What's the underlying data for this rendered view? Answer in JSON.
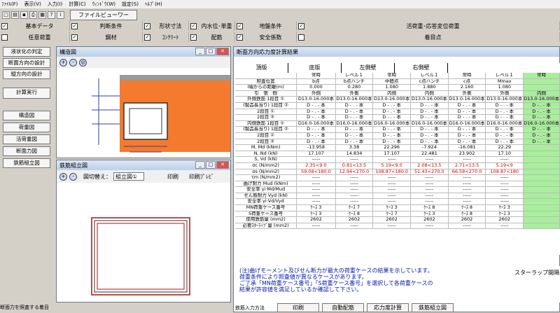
{
  "menu": [
    "ﾌｧｲﾙ(F)",
    "表示(V)",
    "入力(I)",
    "計算(C)",
    "ｳｨﾝﾄﾞｳ(W)",
    "設定(S)",
    "ﾍﾙﾌﾟ(H)"
  ],
  "toolbar": {
    "file_viewer": "ファイルビューワー"
  },
  "checks_row1": [
    {
      "label": "基本データ",
      "checked": true
    },
    {
      "label": "判断条件",
      "checked": true
    },
    {
      "label": "形状寸法",
      "checked": true
    },
    {
      "label": "内水位･単重",
      "checked": true
    },
    {
      "label": "地盤条件",
      "checked": true
    },
    {
      "label": "活荷重･応答変位荷重",
      "checked": true
    }
  ],
  "checks_row2": [
    {
      "label": "任意荷重",
      "checked": false
    },
    {
      "label": "鋼材",
      "checked": true
    },
    {
      "label": "ｺﾝｸﾘｰﾄ",
      "checked": true
    },
    {
      "label": "配筋",
      "checked": true
    },
    {
      "label": "安全係数",
      "checked": true
    },
    {
      "label": "着目点",
      "checked": false
    }
  ],
  "left_buttons": [
    "液状化の判定",
    "断面方向の設計",
    "縦方向の設計",
    "計算実行",
    "構造図",
    "荷重図",
    "活荷重図",
    "断面力図",
    "鉄筋組立図"
  ],
  "struct_window": {
    "title": "構造図"
  },
  "rebar_window": {
    "title": "鉄筋組立図",
    "switch_label": "図切替え：",
    "select_value": "組立図①",
    "print": "印刷",
    "print_preview": "印刷ﾌﾟﾚﾋﾞ"
  },
  "result_window": {
    "title": "断面方向応力度計算結果"
  },
  "tabs": [
    "頂版",
    "底版",
    "左側壁",
    "右側壁"
  ],
  "table": {
    "header": [
      [
        "",
        "常時",
        "レベル１",
        "常時",
        "レベル１",
        "常時",
        "レベル１",
        "常時"
      ],
      [
        "照査位置",
        "b点",
        "b点ハンチ",
        "中間点",
        "c点ハンチ",
        "c点",
        "Mmax",
        ""
      ],
      [
        "Ⅰ端からの距離(m)",
        "0.000",
        "0.280",
        "1.080",
        "1.880",
        "2.160",
        "1.080",
        ""
      ],
      [
        "引　張　側",
        "外側",
        "外側",
        "内側",
        "内側",
        "外側",
        "外側",
        "内側"
      ]
    ],
    "body": [
      [
        "外側鉄筋 1段目 ①",
        "D13.0-16.000本",
        "D13.0-16.000本",
        "D13.0-16.000本",
        "D13.0-16.000本",
        "D13.0-16.000本",
        "D13.0-16.000本",
        "D13.0-16.000本"
      ],
      [
        "(製品長当り) 1段目 ②",
        "D - . - 本",
        "D - . - 本",
        "D - . - 本",
        "D - . - 本",
        "D - . - 本",
        "D - . - 本",
        "D - . - 本"
      ],
      [
        "2段目 ①",
        "D - . - 本",
        "D - . - 本",
        "D - . - 本",
        "D - . - 本",
        "D - . - 本",
        "D - . - 本",
        "D - . - 本"
      ],
      [
        "2段目 ②",
        "D - . - 本",
        "D - . - 本",
        "D - . - 本",
        "D - . - 本",
        "D - . - 本",
        "D - . - 本",
        "D - . - 本"
      ],
      [
        "内側鉄筋 1段目 ①",
        "D16.0-16.000本",
        "D16.0-16.000本",
        "D16.0-16.000本",
        "D16.0-16.000本",
        "D16.0-16.000本",
        "D16.0-16.000本",
        "D16.0-16.000本"
      ],
      [
        "(製品長当り) 1段目 ②",
        "D - . - 本",
        "D - . - 本",
        "D - . - 本",
        "D - . - 本",
        "D - . - 本",
        "D - . - 本",
        "D - . - 本"
      ],
      [
        "2段目 ①",
        "D - . - 本",
        "D - . - 本",
        "D - . - 本",
        "D - . - 本",
        "D - . - 本",
        "D - . - 本",
        "D - . - 本"
      ],
      [
        "2段目 ②",
        "D - . - 本",
        "D - . - 本",
        "D - . - 本",
        "D - . - 本",
        "D - . - 本",
        "D - . - 本",
        "D - . - 本"
      ],
      [
        "M, Md (kNm)",
        "-13.958",
        "3.38",
        "22.296",
        "-7.924",
        "-16.081",
        "22.29",
        ""
      ],
      [
        "N, Nd (kN)",
        "17.107",
        "14.834",
        "17.107",
        "22.481",
        "23.902",
        "17.10",
        ""
      ],
      [
        "S, Vd (kN)",
        "-----",
        "-----",
        "-----",
        "-----",
        "-----",
        "-----",
        ""
      ],
      [
        "σc (N/mm2)",
        "2.35<9.0",
        "0.81<13.5",
        "5.19<9.0",
        "2.08<13.5",
        "2.71<13.5",
        "5.19<9",
        ""
      ],
      [
        "σs (N/mm2)",
        "59.08<180.0",
        "12.94<270.0",
        "108.87<180.0",
        "51.43<270.0",
        "66.58<270.0",
        "108.87<180",
        ""
      ],
      [
        "τm (N/mm2)",
        "-----",
        "-----",
        "-----",
        "-----",
        "-----",
        "-----",
        ""
      ],
      [
        "曲げ耐力 Mud (kNm)",
        "-----",
        "-----",
        "-----",
        "-----",
        "-----",
        "-----",
        ""
      ],
      [
        "安全率 γi·Md/Mud",
        "-----",
        "-----",
        "-----",
        "-----",
        "-----",
        "-----",
        ""
      ],
      [
        "せん断耐力 Vyd (kN)",
        "-----",
        "-----",
        "-----",
        "-----",
        "-----",
        "-----",
        ""
      ],
      [
        "安全率 γi·Vd/Vyd",
        "-----",
        "-----",
        "-----",
        "-----",
        "-----",
        "-----",
        ""
      ],
      [
        "MN荷重ケース番号",
        "ｹｰｽ 3",
        "ｹｰｽ 7",
        "ｹｰｽ 3",
        "ｹｰｽ 8",
        "ｹｰｽ 8",
        "ｹｰｽ 3",
        ""
      ],
      [
        "S荷重ケース番号",
        "ｹｰｽ 3",
        "ｹｰｽ 8",
        "ｹｰｽ 7",
        "ｹｰｽ 3",
        "ｹｰｽ 8",
        "ｹｰｽ 3",
        ""
      ],
      [
        "使用鉄筋量 (mm2)",
        "2602",
        "2602",
        "2602",
        "2602",
        "2602",
        "2602",
        ""
      ],
      [
        "必要ｽﾀｰﾗｯﾌﾟ量 (mm2)",
        "-----",
        "-----",
        "-----",
        "-----",
        "-----",
        "-----",
        ""
      ]
    ]
  },
  "note_lines": [
    "(注)曲げモーメント及びせん断力が最大の荷重ケースの結果を示しています。",
    "荷重条件により照査値が異なるケースがあります。",
    "ご了承「MN荷重ケース番号」「S荷重ケース番号」を選択して各荷重ケースの",
    "結果が許容値を満足しているか確認して下さい。"
  ],
  "stirrup_label": "スターラップ間隔",
  "rebar_input_label": "鉄筋入力方法",
  "bottom_buttons": [
    "印刷",
    "自動配筋",
    "応力度計算",
    "鉄筋組立図"
  ],
  "status_left": "断面力を照査する着目",
  "colors": {
    "soil": "#f47a2d",
    "highlight": "#a8ef9c",
    "note": "#0018a8"
  }
}
